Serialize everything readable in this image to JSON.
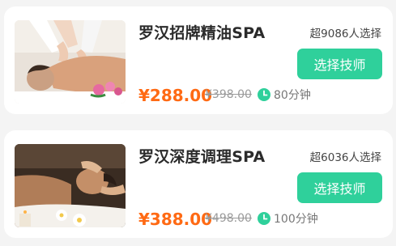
{
  "services": [
    {
      "title": "罗汉招牌精油SPA",
      "chosen": "超9086人选择",
      "button": "选择技师",
      "price": "¥288.00",
      "original_price": "¥398.00",
      "duration": "80分钟",
      "image_icon": "back-massage-photo"
    },
    {
      "title": "罗汉深度调理SPA",
      "chosen": "超6036人选择",
      "button": "选择技师",
      "price": "¥388.00",
      "original_price": "¥498.00",
      "duration": "100分钟",
      "image_icon": "face-massage-photo"
    }
  ],
  "colors": {
    "accent": "#2fd09b",
    "price": "#ff6a14",
    "background": "#f4f4f4",
    "card": "#ffffff"
  },
  "icons": {
    "duration": "clock-icon"
  }
}
